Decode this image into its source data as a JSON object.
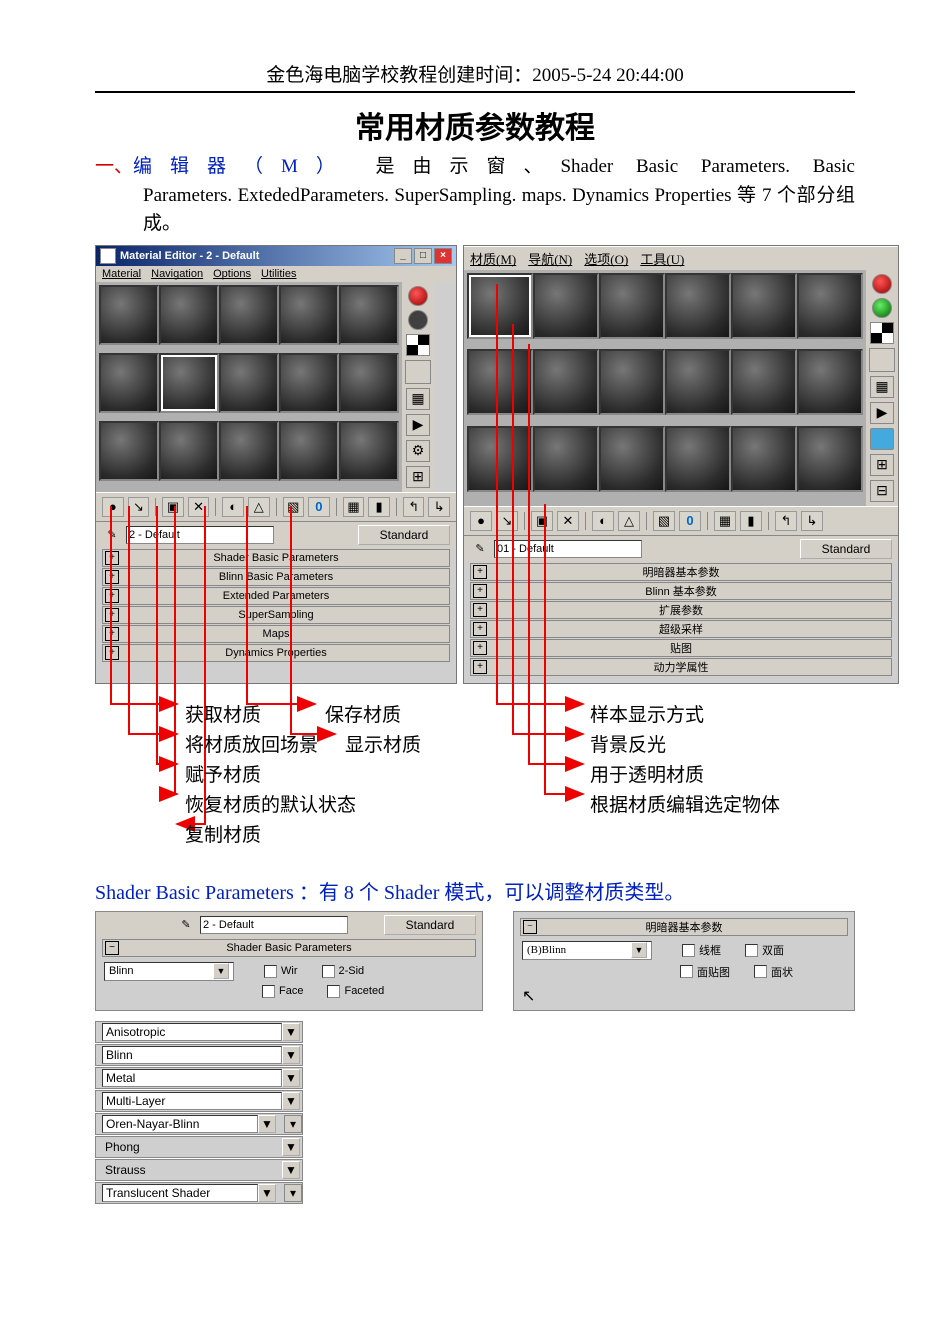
{
  "header": "金色海电脑学校教程创建时间：2005-5-24 20:44:00",
  "title": "常用材质参数教程",
  "intro": {
    "num": "一、",
    "head": "编辑器（M）",
    "rest1": "是由示窗、Shader Basic Parameters. Basic",
    "rest2": "Parameters. ExtededParameters. SuperSampling. maps. Dynamics Properties 等 7 个部分组成。"
  },
  "winA": {
    "title": "Material Editor - 2 - Default",
    "menu": [
      "Material",
      "Navigation",
      "Options",
      "Utilities"
    ],
    "name_field": "2 - Default",
    "std_btn": "Standard",
    "rollouts": [
      "Shader Basic Parameters",
      "Blinn Basic Parameters",
      "Extended Parameters",
      "SuperSampling",
      "Maps",
      "Dynamics Properties"
    ]
  },
  "winB": {
    "menu": [
      "材质(M)",
      "导航(N)",
      "选项(O)",
      "工具(U)"
    ],
    "name_field": "01 - Default",
    "std_btn": "Standard",
    "rollouts": [
      "明暗器基本参数",
      "Blinn 基本参数",
      "扩展参数",
      "超级采样",
      "贴图",
      "动力学属性"
    ]
  },
  "annotations_left": [
    "获取材质",
    "保存材质",
    "将材质放回场景",
    "显示材质",
    "赋予材质",
    "恢复材质的默认状态",
    "复制材质"
  ],
  "annotations_right": [
    "样本显示方式",
    "背景反光",
    "用于透明材质",
    "根据材质编辑选定物体"
  ],
  "section2": {
    "head": "Shader Basic Parameters ：有 8 个 Shader 模式，可以调整材质类型。"
  },
  "panelA": {
    "name_field": "2 - Default",
    "std_btn": "Standard",
    "roll_title": "Shader Basic Parameters",
    "shader": "Blinn",
    "checks": [
      "Wir",
      "2-Sid",
      "Face",
      "Faceted"
    ]
  },
  "panelB": {
    "roll_title": "明暗器基本参数",
    "shader": "(B)Blinn",
    "checks": [
      "线框",
      "双面",
      "面贴图",
      "面状"
    ]
  },
  "shader_modes": [
    "Anisotropic",
    "Blinn",
    "Metal",
    "Multi-Layer",
    "Oren-Nayar-Blinn",
    "Phong",
    "Strauss",
    "Translucent Shader"
  ]
}
